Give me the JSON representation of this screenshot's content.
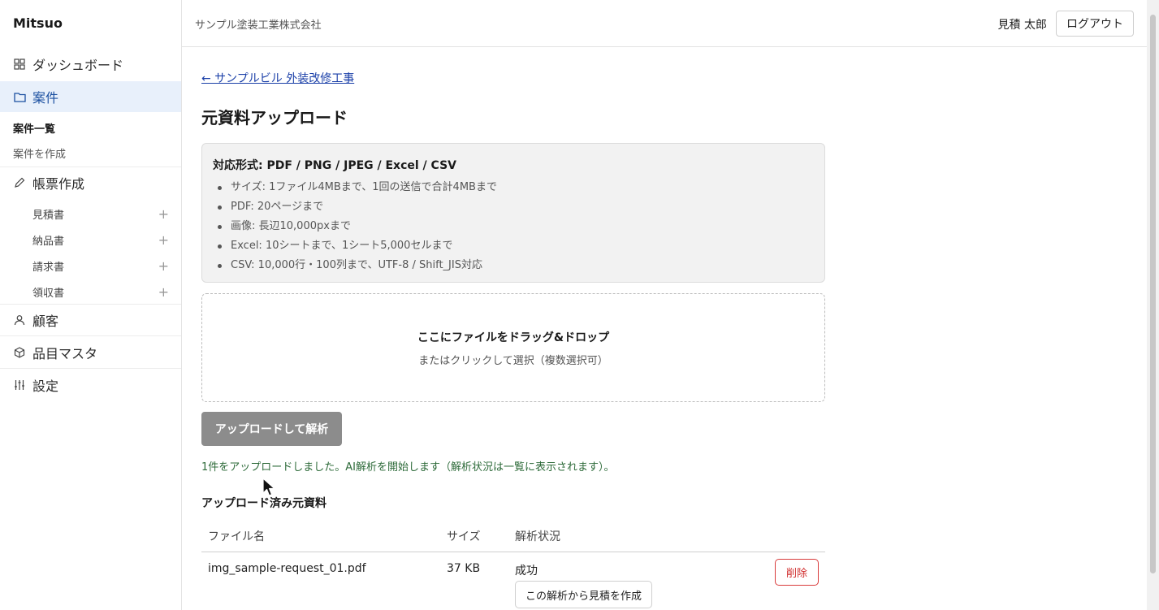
{
  "brand": "Mitsuo",
  "sidebar": {
    "items": [
      {
        "label": "ダッシュボード",
        "icon": "grid-icon"
      },
      {
        "label": "案件",
        "icon": "folder-icon"
      },
      {
        "label": "帳票作成",
        "icon": "pencil-icon"
      },
      {
        "label": "顧客",
        "icon": "user-icon"
      },
      {
        "label": "品目マスタ",
        "icon": "box-icon"
      },
      {
        "label": "設定",
        "icon": "sliders-icon"
      }
    ],
    "project_sub": [
      {
        "label": "案件一覧"
      },
      {
        "label": "案件を作成"
      }
    ],
    "forms": [
      {
        "label": "見積書",
        "action": "+"
      },
      {
        "label": "納品書",
        "action": "+"
      },
      {
        "label": "請求書",
        "action": "+"
      },
      {
        "label": "領収書",
        "action": "+"
      }
    ]
  },
  "header": {
    "company": "サンプル塗装工業株式会社",
    "user": "見積 太郎",
    "logout_label": "ログアウト"
  },
  "main": {
    "back_link": "← サンプルビル 外装改修工事",
    "title": "元資料アップロード",
    "formats_title": "対応形式: PDF / PNG / JPEG / Excel / CSV",
    "formats": [
      "サイズ: 1ファイル4MBまで、1回の送信で合計4MBまで",
      "PDF: 20ページまで",
      "画像: 長辺10,000pxまで",
      "Excel: 10シートまで、1シート5,000セルまで",
      "CSV: 10,000行・100列まで、UTF-8 / Shift_JIS対応"
    ],
    "dropzone_main": "ここにファイルをドラッグ&ドロップ",
    "dropzone_sub": "またはクリックして選択（複数選択可）",
    "upload_label": "アップロードして解析",
    "success_message": "1件をアップロードしました。AI解析を開始します（解析状況は一覧に表示されます）。",
    "uploaded_title": "アップロード済み元資料",
    "table": {
      "headers": [
        "ファイル名",
        "サイズ",
        "解析状況"
      ],
      "rows": [
        {
          "filename": "img_sample-request_01.pdf",
          "size": "37 KB",
          "status": "成功",
          "create_label": "この解析から見積を作成",
          "delete_label": "削除"
        }
      ]
    }
  },
  "colors": {
    "accent": "#1a4fa0",
    "active_bg": "#e8f0fb",
    "success": "#2e6b3a",
    "danger": "#d02b2b",
    "disabled_button": "#8c8c8c"
  }
}
